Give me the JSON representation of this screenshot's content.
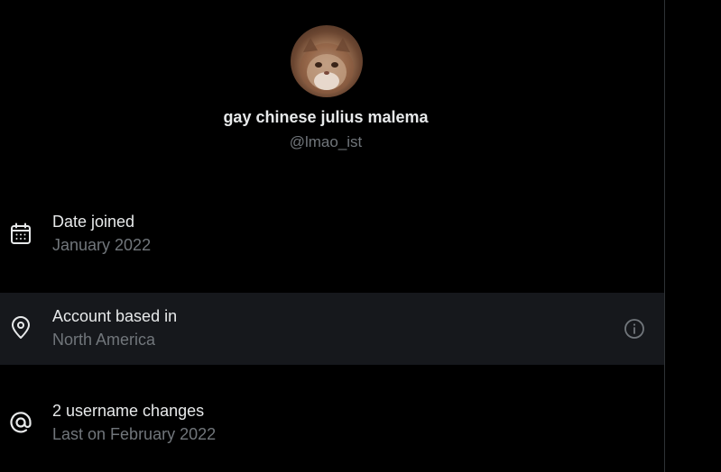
{
  "profile": {
    "display_name": "gay chinese julius malema",
    "handle": "@lmao_ist"
  },
  "rows": [
    {
      "icon": "calendar-icon",
      "title": "Date joined",
      "subtitle": "January 2022"
    },
    {
      "icon": "location-pin-icon",
      "title": "Account based in",
      "subtitle": "North America",
      "trailing_icon": "info-icon"
    },
    {
      "icon": "at-sign-icon",
      "title": "2 username changes",
      "subtitle": "Last on February 2022"
    }
  ],
  "colors": {
    "background": "#000000",
    "primary_text": "#e7e9ea",
    "secondary_text": "#71767b",
    "highlight_row": "#16181c",
    "divider": "#2f3336"
  }
}
